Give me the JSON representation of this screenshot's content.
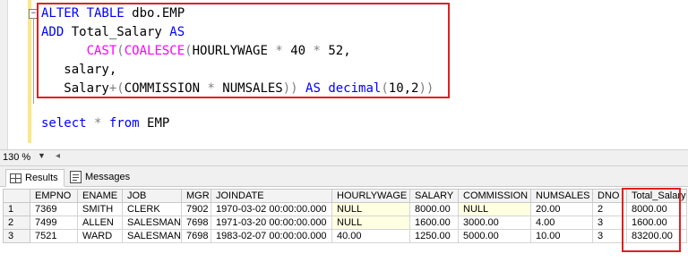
{
  "editor": {
    "code": [
      [
        [
          "kw",
          "ALTER TABLE "
        ],
        [
          "plain",
          "dbo.EMP"
        ]
      ],
      [
        [
          "kw",
          "ADD "
        ],
        [
          "plain",
          "Total_Salary "
        ],
        [
          "kw",
          "AS"
        ]
      ],
      [
        [
          "plain",
          "      "
        ],
        [
          "fn",
          "CAST"
        ],
        [
          "op",
          "("
        ],
        [
          "fn",
          "COALESCE"
        ],
        [
          "op",
          "("
        ],
        [
          "plain",
          "HOURLYWAGE "
        ],
        [
          "op",
          "*"
        ],
        [
          "plain",
          " 40 "
        ],
        [
          "op",
          "*"
        ],
        [
          "plain",
          " 52,"
        ]
      ],
      [
        [
          "plain",
          "   salary,"
        ]
      ],
      [
        [
          "plain",
          "   Salary"
        ],
        [
          "op",
          "+("
        ],
        [
          "plain",
          "COMMISSION "
        ],
        [
          "op",
          "*"
        ],
        [
          "plain",
          " NUMSALES"
        ],
        [
          "op",
          "))"
        ],
        [
          "kw",
          " AS "
        ],
        [
          "kw",
          "decimal"
        ],
        [
          "op",
          "("
        ],
        [
          "plain",
          "10,2"
        ],
        [
          "op",
          "))"
        ]
      ]
    ],
    "select_line": [
      [
        "kw",
        "select "
      ],
      [
        "op",
        "* "
      ],
      [
        "kw",
        "from "
      ],
      [
        "plain",
        "EMP"
      ]
    ]
  },
  "zoom": {
    "value": "130 %"
  },
  "tabs": [
    {
      "label": "Results",
      "icon": "grid-icon",
      "active": true
    },
    {
      "label": "Messages",
      "icon": "messages-icon",
      "active": false
    }
  ],
  "grid": {
    "columns": [
      "EMPNO",
      "ENAME",
      "JOB",
      "MGR",
      "JOINDATE",
      "HOURLYWAGE",
      "SALARY",
      "COMMISSION",
      "NUMSALES",
      "DNO",
      "Total_Salary"
    ],
    "rows": [
      [
        "1",
        "7369",
        "SMITH",
        "CLERK",
        "7902",
        "1970-03-02 00:00:00.000",
        "NULL",
        "8000.00",
        "NULL",
        "20.00",
        "2",
        "8000.00"
      ],
      [
        "2",
        "7499",
        "ALLEN",
        "SALESMAN",
        "7698",
        "1971-03-20 00:00:00.000",
        "NULL",
        "1600.00",
        "3000.00",
        "4.00",
        "3",
        "1600.00"
      ],
      [
        "3",
        "7521",
        "WARD",
        "SALESMAN",
        "7698",
        "1983-02-07 00:00:00.000",
        "40.00",
        "1250.00",
        "5000.00",
        "10.00",
        "3",
        "83200.00"
      ]
    ]
  },
  "colors": {
    "keyword": "#0000ff",
    "function": "#ff00ff",
    "operator": "#808080",
    "highlight_border": "#e02020",
    "null_cell": "#ffffe1"
  }
}
